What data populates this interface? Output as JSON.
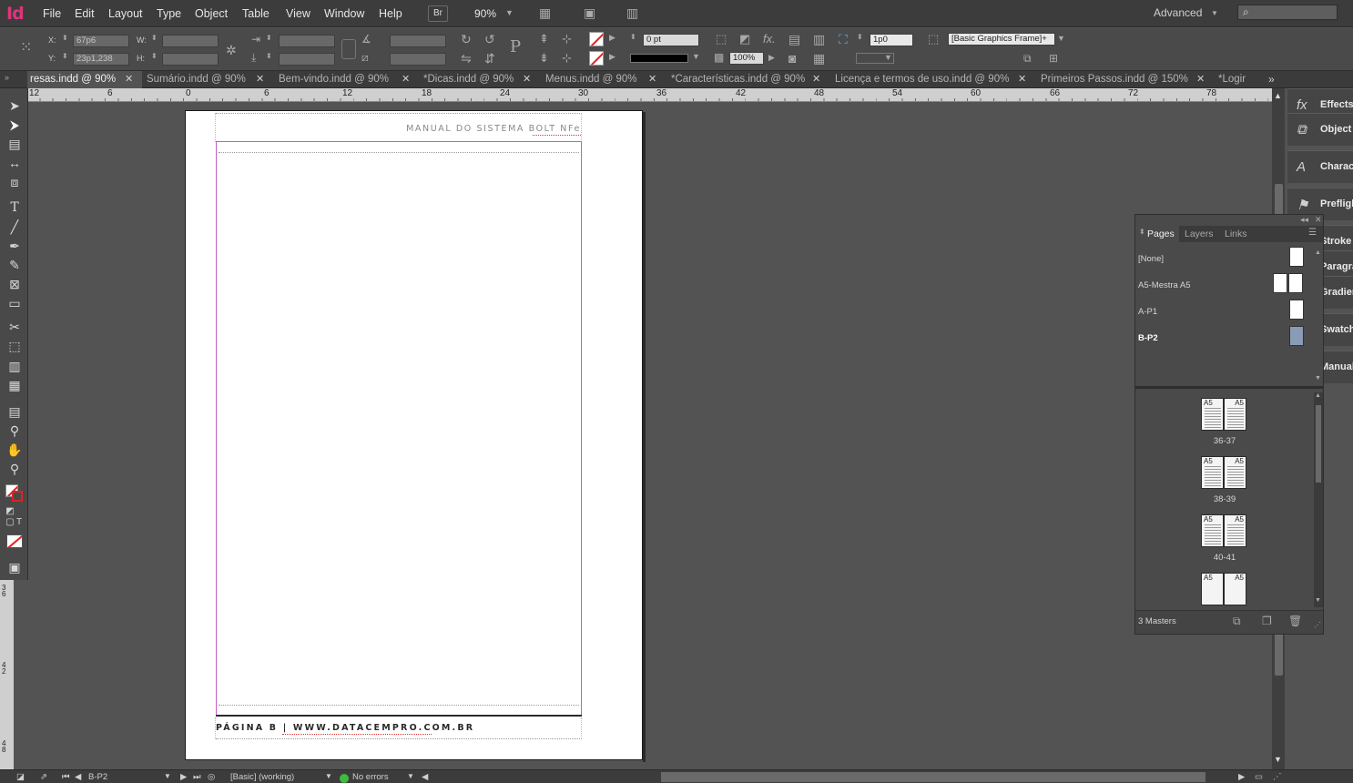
{
  "app": {
    "logo": "Id",
    "zoom": "90%",
    "workspace": "Advanced"
  },
  "menu": [
    "File",
    "Edit",
    "Layout",
    "Type",
    "Object",
    "Table",
    "View",
    "Window",
    "Help"
  ],
  "toolbar": {
    "bridge_label": "Br"
  },
  "control": {
    "x_label": "X:",
    "x_value": "67p6",
    "y_label": "Y:",
    "y_value": "23p1,238",
    "w_label": "W:",
    "h_label": "H:",
    "stroke_weight": "0 pt",
    "opacity": "100%",
    "frame_fitting": "1p0",
    "object_style": "[Basic Graphics Frame]+",
    "fx_label": "fx."
  },
  "tabs": [
    {
      "label": "resas.indd @ 90%",
      "active": true
    },
    {
      "label": "Sumário.indd @ 90%",
      "active": false
    },
    {
      "label": "Bem-vindo.indd @ 90%",
      "active": false
    },
    {
      "label": "*Dicas.indd @ 90%",
      "active": false
    },
    {
      "label": "Menus.indd @ 90%",
      "active": false
    },
    {
      "label": "*Características.indd @ 90%",
      "active": false
    },
    {
      "label": "Licença e termos de uso.indd @ 90%",
      "active": false
    },
    {
      "label": "Primeiros Passos.indd @ 150%",
      "active": false
    },
    {
      "label": "*Logir",
      "active": false
    }
  ],
  "ruler": {
    "h_labels": [
      "12",
      "6",
      "0",
      "6",
      "12",
      "18",
      "24",
      "30",
      "36",
      "42",
      "48",
      "54",
      "60",
      "66",
      "72",
      "78"
    ],
    "v_labels": [
      "3 6",
      "4 2",
      "4 8"
    ]
  },
  "document": {
    "header": "MANUAL DO SISTEMA BOLT NFe",
    "footer": "PÁGINA B | WWW.DATACEMPRO.COM.BR"
  },
  "right_panels": [
    "Effects",
    "Object S",
    "Characte",
    "Preflight",
    "Stroke",
    "Paragra",
    "Gradien",
    "Swatche",
    "Manual"
  ],
  "pages_panel": {
    "tabs": [
      "Pages",
      "Layers",
      "Links"
    ],
    "masters": [
      {
        "label": "[None]",
        "selected": false
      },
      {
        "label": "A5-Mestra A5",
        "selected": false
      },
      {
        "label": "A-P1",
        "selected": false
      },
      {
        "label": "B-P2",
        "selected": true
      }
    ],
    "spreads": [
      {
        "label": "36-37",
        "left": "A5",
        "right": "A5"
      },
      {
        "label": "38-39",
        "left": "A5",
        "right": "A5"
      },
      {
        "label": "40-41",
        "left": "A5",
        "right": "A5"
      },
      {
        "label": "",
        "left": "A5",
        "right": "A5"
      }
    ],
    "footer": "3 Masters"
  },
  "status": {
    "page": "B-P2",
    "preflight_profile": "[Basic] (working)",
    "errors": "No errors"
  }
}
